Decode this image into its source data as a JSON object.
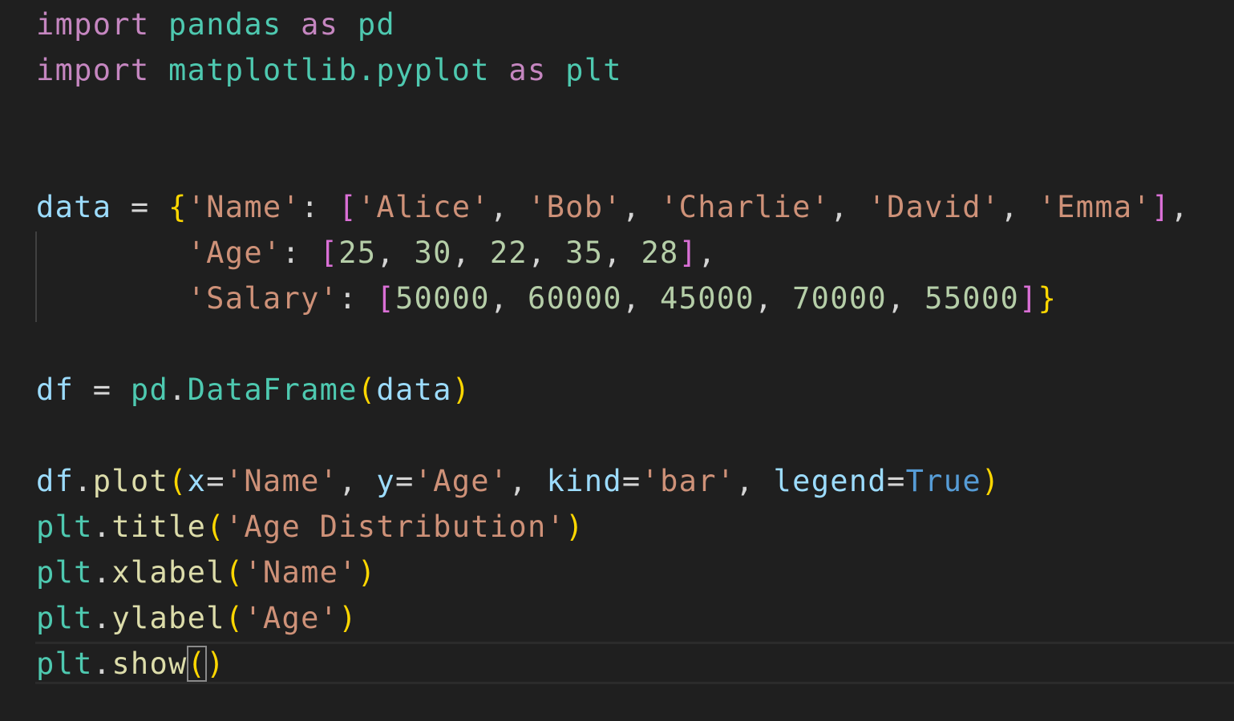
{
  "colors": {
    "background": "#1f1f1f",
    "keyword": "#c586c0",
    "module": "#4ec9b0",
    "variable": "#9cdcfe",
    "string": "#ce9178",
    "number": "#b5cea8",
    "function": "#dcdcaa",
    "constant": "#569cd6",
    "bracket_gold": "#ffd700",
    "bracket_purple": "#da70d6",
    "bracket_blue": "#179fff",
    "operator": "#d4d4d4"
  },
  "lines": [
    {
      "tokens": [
        {
          "t": "import",
          "c": "keyword"
        },
        {
          "t": " ",
          "c": "operator"
        },
        {
          "t": "pandas",
          "c": "module"
        },
        {
          "t": " ",
          "c": "operator"
        },
        {
          "t": "as",
          "c": "keyword"
        },
        {
          "t": " ",
          "c": "operator"
        },
        {
          "t": "pd",
          "c": "module"
        }
      ]
    },
    {
      "tokens": [
        {
          "t": "import",
          "c": "keyword"
        },
        {
          "t": " ",
          "c": "operator"
        },
        {
          "t": "matplotlib.pyplot",
          "c": "module"
        },
        {
          "t": " ",
          "c": "operator"
        },
        {
          "t": "as",
          "c": "keyword"
        },
        {
          "t": " ",
          "c": "operator"
        },
        {
          "t": "plt",
          "c": "module"
        }
      ]
    },
    {
      "tokens": []
    },
    {
      "tokens": []
    },
    {
      "tokens": [
        {
          "t": "data",
          "c": "variable"
        },
        {
          "t": " = ",
          "c": "operator"
        },
        {
          "t": "{",
          "c": "bracket_gold"
        },
        {
          "t": "'Name'",
          "c": "string"
        },
        {
          "t": ": ",
          "c": "operator"
        },
        {
          "t": "[",
          "c": "bracket_purple"
        },
        {
          "t": "'Alice'",
          "c": "string"
        },
        {
          "t": ", ",
          "c": "operator"
        },
        {
          "t": "'Bob'",
          "c": "string"
        },
        {
          "t": ", ",
          "c": "operator"
        },
        {
          "t": "'Charlie'",
          "c": "string"
        },
        {
          "t": ", ",
          "c": "operator"
        },
        {
          "t": "'David'",
          "c": "string"
        },
        {
          "t": ", ",
          "c": "operator"
        },
        {
          "t": "'Emma'",
          "c": "string"
        },
        {
          "t": "]",
          "c": "bracket_purple"
        },
        {
          "t": ",",
          "c": "operator"
        }
      ]
    },
    {
      "tokens": [
        {
          "t": "        ",
          "c": "operator"
        },
        {
          "t": "'Age'",
          "c": "string"
        },
        {
          "t": ": ",
          "c": "operator"
        },
        {
          "t": "[",
          "c": "bracket_purple"
        },
        {
          "t": "25",
          "c": "number"
        },
        {
          "t": ", ",
          "c": "operator"
        },
        {
          "t": "30",
          "c": "number"
        },
        {
          "t": ", ",
          "c": "operator"
        },
        {
          "t": "22",
          "c": "number"
        },
        {
          "t": ", ",
          "c": "operator"
        },
        {
          "t": "35",
          "c": "number"
        },
        {
          "t": ", ",
          "c": "operator"
        },
        {
          "t": "28",
          "c": "number"
        },
        {
          "t": "]",
          "c": "bracket_purple"
        },
        {
          "t": ",",
          "c": "operator"
        }
      ]
    },
    {
      "tokens": [
        {
          "t": "        ",
          "c": "operator"
        },
        {
          "t": "'Salary'",
          "c": "string"
        },
        {
          "t": ": ",
          "c": "operator"
        },
        {
          "t": "[",
          "c": "bracket_purple"
        },
        {
          "t": "50000",
          "c": "number"
        },
        {
          "t": ", ",
          "c": "operator"
        },
        {
          "t": "60000",
          "c": "number"
        },
        {
          "t": ", ",
          "c": "operator"
        },
        {
          "t": "45000",
          "c": "number"
        },
        {
          "t": ", ",
          "c": "operator"
        },
        {
          "t": "70000",
          "c": "number"
        },
        {
          "t": ", ",
          "c": "operator"
        },
        {
          "t": "55000",
          "c": "number"
        },
        {
          "t": "]",
          "c": "bracket_purple"
        },
        {
          "t": "}",
          "c": "bracket_gold"
        }
      ]
    },
    {
      "tokens": []
    },
    {
      "tokens": [
        {
          "t": "df",
          "c": "variable"
        },
        {
          "t": " = ",
          "c": "operator"
        },
        {
          "t": "pd",
          "c": "module"
        },
        {
          "t": ".",
          "c": "operator"
        },
        {
          "t": "DataFrame",
          "c": "module"
        },
        {
          "t": "(",
          "c": "bracket_gold"
        },
        {
          "t": "data",
          "c": "variable"
        },
        {
          "t": ")",
          "c": "bracket_gold"
        }
      ]
    },
    {
      "tokens": []
    },
    {
      "tokens": [
        {
          "t": "df",
          "c": "variable"
        },
        {
          "t": ".",
          "c": "operator"
        },
        {
          "t": "plot",
          "c": "function"
        },
        {
          "t": "(",
          "c": "bracket_gold"
        },
        {
          "t": "x",
          "c": "variable"
        },
        {
          "t": "=",
          "c": "operator"
        },
        {
          "t": "'Name'",
          "c": "string"
        },
        {
          "t": ", ",
          "c": "operator"
        },
        {
          "t": "y",
          "c": "variable"
        },
        {
          "t": "=",
          "c": "operator"
        },
        {
          "t": "'Age'",
          "c": "string"
        },
        {
          "t": ", ",
          "c": "operator"
        },
        {
          "t": "kind",
          "c": "variable"
        },
        {
          "t": "=",
          "c": "operator"
        },
        {
          "t": "'bar'",
          "c": "string"
        },
        {
          "t": ", ",
          "c": "operator"
        },
        {
          "t": "legend",
          "c": "variable"
        },
        {
          "t": "=",
          "c": "operator"
        },
        {
          "t": "True",
          "c": "constant"
        },
        {
          "t": ")",
          "c": "bracket_gold"
        }
      ]
    },
    {
      "tokens": [
        {
          "t": "plt",
          "c": "module"
        },
        {
          "t": ".",
          "c": "operator"
        },
        {
          "t": "title",
          "c": "function"
        },
        {
          "t": "(",
          "c": "bracket_gold"
        },
        {
          "t": "'Age Distribution'",
          "c": "string"
        },
        {
          "t": ")",
          "c": "bracket_gold"
        }
      ]
    },
    {
      "tokens": [
        {
          "t": "plt",
          "c": "module"
        },
        {
          "t": ".",
          "c": "operator"
        },
        {
          "t": "xlabel",
          "c": "function"
        },
        {
          "t": "(",
          "c": "bracket_gold"
        },
        {
          "t": "'Name'",
          "c": "string"
        },
        {
          "t": ")",
          "c": "bracket_gold"
        }
      ]
    },
    {
      "tokens": [
        {
          "t": "plt",
          "c": "module"
        },
        {
          "t": ".",
          "c": "operator"
        },
        {
          "t": "ylabel",
          "c": "function"
        },
        {
          "t": "(",
          "c": "bracket_gold"
        },
        {
          "t": "'Age'",
          "c": "string"
        },
        {
          "t": ")",
          "c": "bracket_gold"
        }
      ]
    },
    {
      "tokens": [
        {
          "t": "plt",
          "c": "module"
        },
        {
          "t": ".",
          "c": "operator"
        },
        {
          "t": "show",
          "c": "function"
        },
        {
          "t": "(",
          "c": "bracket_gold",
          "match": true
        },
        {
          "t": ")",
          "c": "bracket_gold"
        }
      ]
    }
  ]
}
